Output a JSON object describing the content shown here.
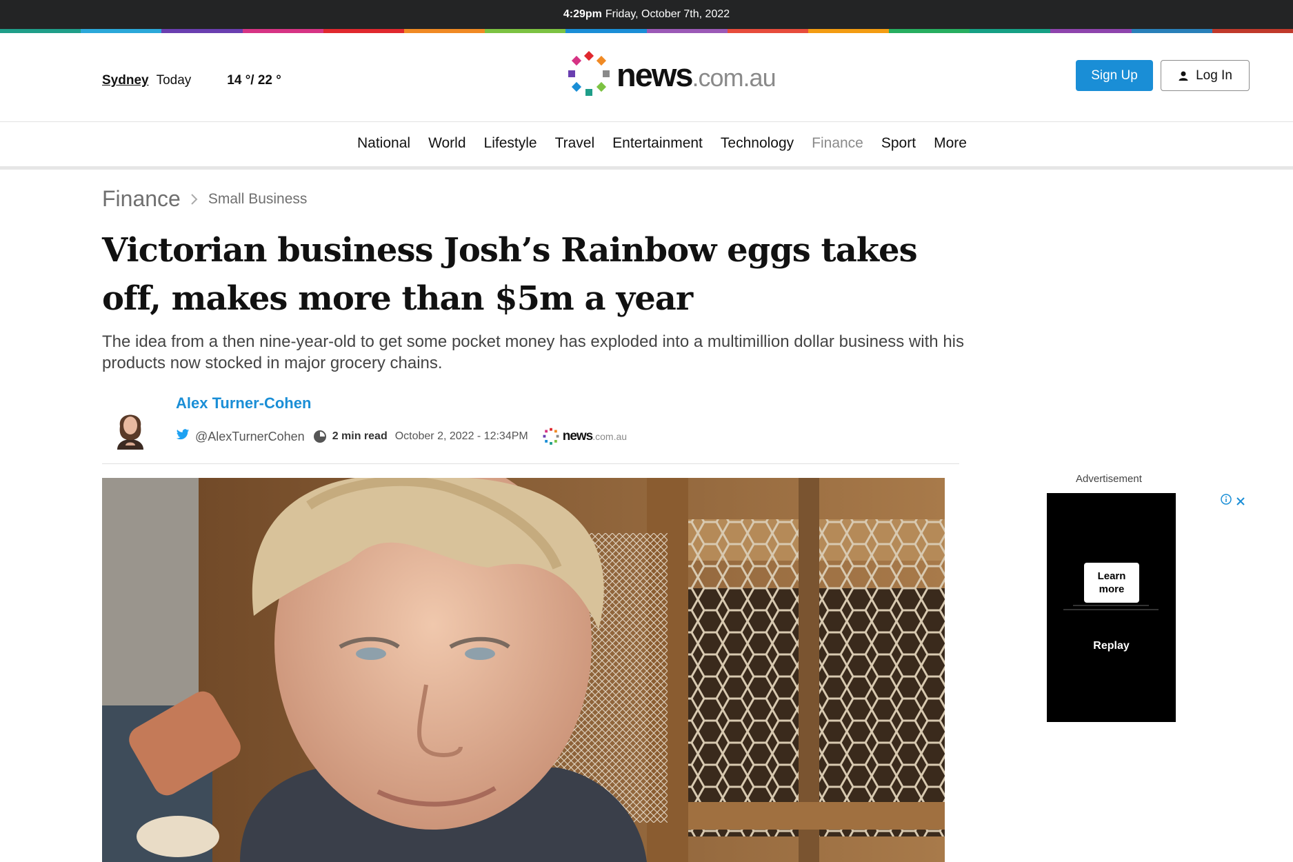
{
  "topbar": {
    "time": "4:29pm",
    "date": "Friday, October 7th, 2022"
  },
  "rainbow_colors": [
    "#1f9e89",
    "#2ba8d9",
    "#6a3fb0",
    "#d63384",
    "#e0282e",
    "#f08a24",
    "#7cc242",
    "#1a8ed6",
    "#9b59b6",
    "#e74c3c",
    "#f39c12",
    "#27ae60",
    "#16a085",
    "#8e44ad",
    "#2980b9",
    "#c0392b"
  ],
  "weather": {
    "city": "Sydney",
    "label": "Today",
    "temp": "14 °/ 22 °"
  },
  "logo": {
    "word": "news",
    "suffix": ".com.au"
  },
  "auth": {
    "signup": "Sign Up",
    "login": "Log In"
  },
  "nav": [
    {
      "label": "National"
    },
    {
      "label": "World"
    },
    {
      "label": "Lifestyle"
    },
    {
      "label": "Travel"
    },
    {
      "label": "Entertainment"
    },
    {
      "label": "Technology"
    },
    {
      "label": "Finance",
      "active": true
    },
    {
      "label": "Sport"
    },
    {
      "label": "More"
    }
  ],
  "breadcrumb": {
    "section": "Finance",
    "subsection": "Small Business"
  },
  "article": {
    "headline": "Victorian business Josh’s Rainbow eggs takes off, makes more than $5m a year",
    "standfirst": "The idea from a then nine-year-old to get some pocket money has exploded into a multimillion dollar business with his products now stocked in major grocery chains.",
    "author": "Alex Turner-Cohen",
    "twitter": "@AlexTurnerCohen",
    "read_time": "2 min read",
    "published": "October 2, 2022 - 12:34PM",
    "source_logo": {
      "word": "news",
      "suffix": ".com.au"
    }
  },
  "advert": {
    "label": "Advertisement",
    "learn_more": "Learn more",
    "replay": "Replay"
  }
}
